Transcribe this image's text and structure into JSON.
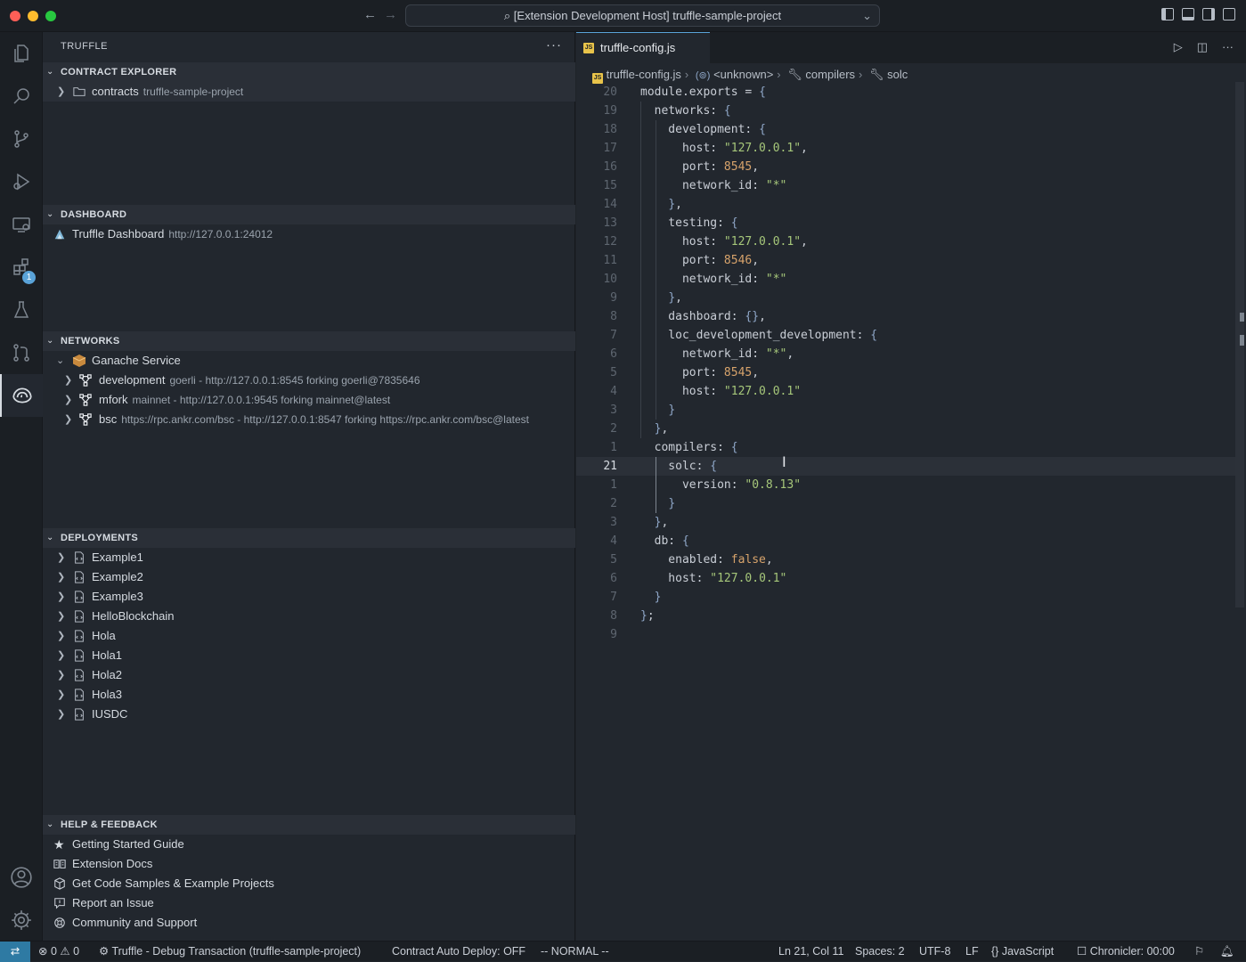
{
  "window": {
    "title": "[Extension Development Host] truffle-sample-project"
  },
  "activity_bar": {
    "extensions_badge": "1"
  },
  "sidebar": {
    "title": "TRUFFLE",
    "contract_explorer": {
      "title": "CONTRACT EXPLORER",
      "items": [
        {
          "label": "contracts",
          "desc": "truffle-sample-project"
        }
      ]
    },
    "dashboard": {
      "title": "DASHBOARD",
      "items": [
        {
          "label": "Truffle Dashboard",
          "desc": "http://127.0.0.1:24012"
        }
      ]
    },
    "networks": {
      "title": "NETWORKS",
      "service": "Ganache Service",
      "items": [
        {
          "label": "development",
          "desc": "goerli - http://127.0.0.1:8545 forking goerli@7835646"
        },
        {
          "label": "mfork",
          "desc": "mainnet - http://127.0.0.1:9545 forking mainnet@latest"
        },
        {
          "label": "bsc",
          "desc": "https://rpc.ankr.com/bsc - http://127.0.0.1:8547 forking https://rpc.ankr.com/bsc@latest"
        }
      ]
    },
    "deployments": {
      "title": "DEPLOYMENTS",
      "items": [
        "Example1",
        "Example2",
        "Example3",
        "HelloBlockchain",
        "Hola",
        "Hola1",
        "Hola2",
        "Hola3",
        "IUSDC"
      ]
    },
    "help": {
      "title": "HELP & FEEDBACK",
      "items": [
        "Getting Started Guide",
        "Extension Docs",
        "Get Code Samples & Example Projects",
        "Report an Issue",
        "Community and Support"
      ]
    }
  },
  "editor": {
    "tab": "truffle-config.js",
    "breadcrumbs": [
      "truffle-config.js",
      "<unknown>",
      "compilers",
      "solc"
    ],
    "line_numbers": [
      "20",
      "19",
      "18",
      "17",
      "16",
      "15",
      "14",
      "13",
      "12",
      "11",
      "10",
      "9",
      "8",
      "7",
      "6",
      "5",
      "4",
      "3",
      "2",
      "1",
      "21",
      "1",
      "2",
      "3",
      "4",
      "5",
      "6",
      "7",
      "8",
      "9"
    ],
    "lines": [
      "module.exports = {",
      "  networks: {",
      "    development: {",
      "      host: \"127.0.0.1\",",
      "      port: 8545,",
      "      network_id: \"*\"",
      "    },",
      "    testing: {",
      "      host: \"127.0.0.1\",",
      "      port: 8546,",
      "      network_id: \"*\"",
      "    },",
      "    dashboard: {},",
      "    loc_development_development: {",
      "      network_id: \"*\",",
      "      port: 8545,",
      "      host: \"127.0.0.1\"",
      "    }",
      "  },",
      "  compilers: {",
      "    solc: {",
      "      version: \"0.8.13\"",
      "    }",
      "  },",
      "  db: {",
      "    enabled: false,",
      "    host: \"127.0.0.1\"",
      "  }",
      "};",
      ""
    ]
  },
  "status_bar": {
    "errors": "0",
    "warnings": "0",
    "debug": "Truffle - Debug Transaction (truffle-sample-project)",
    "auto_deploy": "Contract Auto Deploy: OFF",
    "mode": "-- NORMAL --",
    "position": "Ln 21, Col 11",
    "spaces": "Spaces: 2",
    "encoding": "UTF-8",
    "eol": "LF",
    "language": "JavaScript",
    "chronicler": "Chronicler: 00:00"
  }
}
